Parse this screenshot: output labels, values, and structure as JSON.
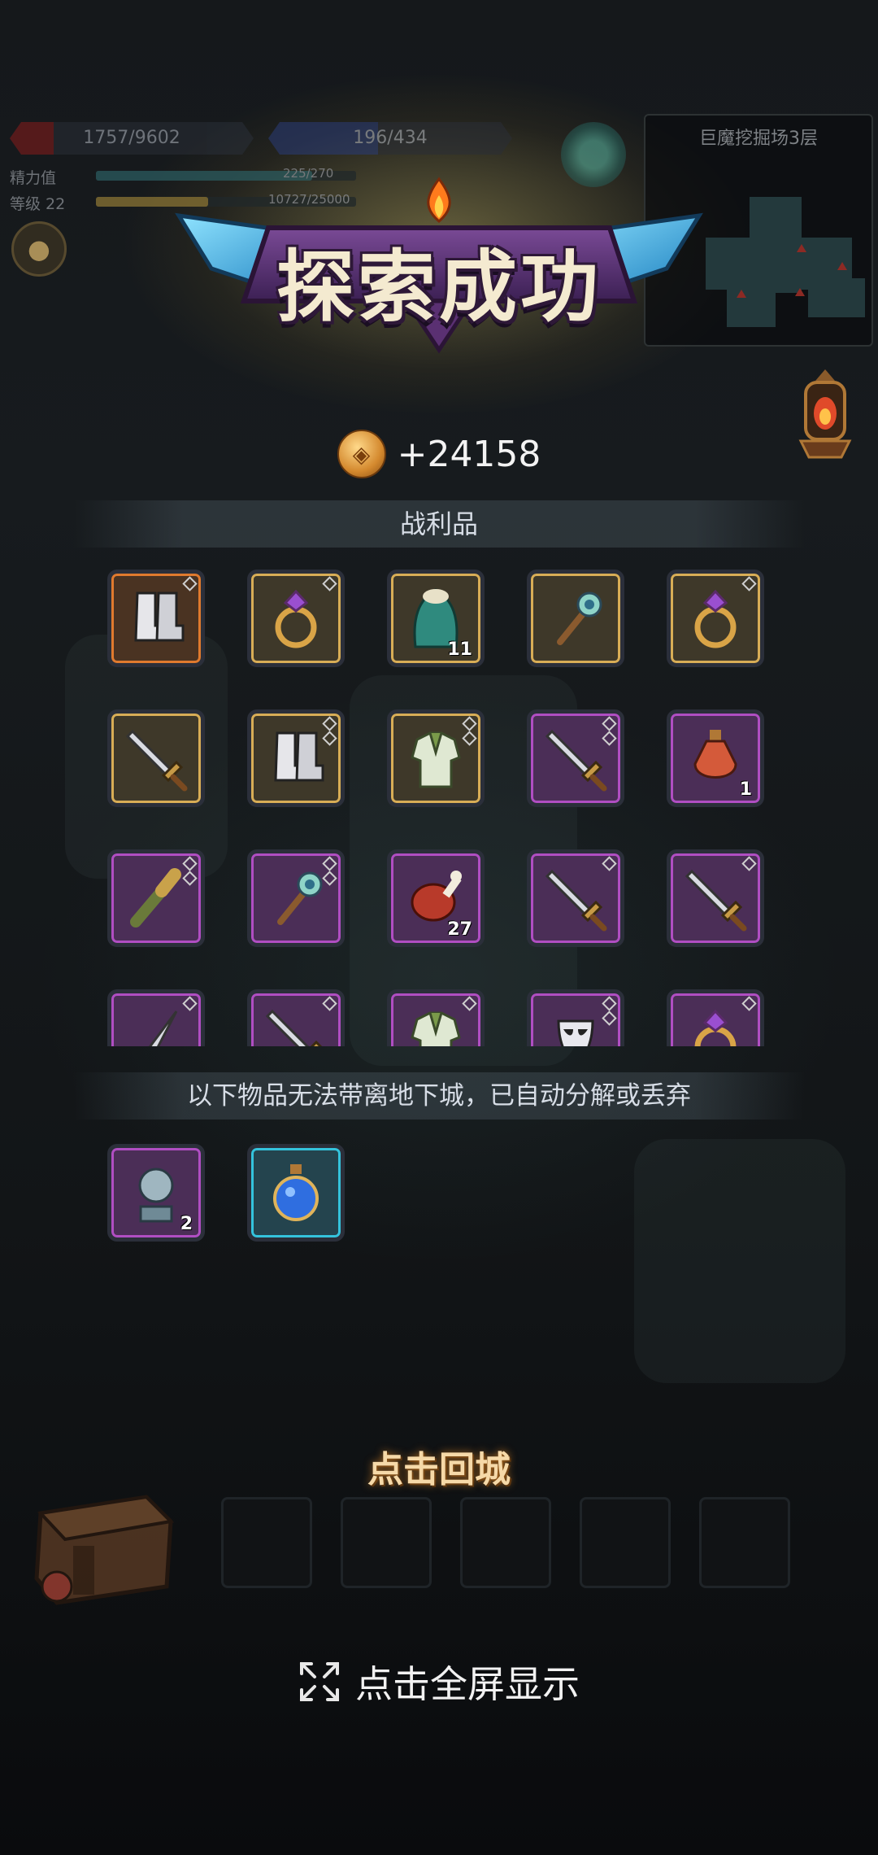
{
  "hud": {
    "hp": "1757/9602",
    "hp_fraction": 0.18,
    "mp": "196/434",
    "mp_fraction": 0.45,
    "stamina_label": "精力值",
    "stamina": "225/270",
    "stamina_fraction": 0.83,
    "level_label": "等级 22",
    "exp": "10727/25000",
    "exp_fraction": 0.43
  },
  "minimap": {
    "title": "巨魔挖掘场3层"
  },
  "banner": {
    "title": "探索成功"
  },
  "reward": {
    "gold": "+24158"
  },
  "loot": {
    "title": "战利品",
    "items": [
      {
        "icon": "boots-icon",
        "rarity": "orange",
        "pips": 1,
        "count": ""
      },
      {
        "icon": "ring-icon",
        "rarity": "gold",
        "pips": 1,
        "count": ""
      },
      {
        "icon": "fur-cloak-icon",
        "rarity": "gold",
        "pips": 0,
        "count": "11"
      },
      {
        "icon": "staff-icon",
        "rarity": "gold",
        "pips": 0,
        "count": ""
      },
      {
        "icon": "ring-icon",
        "rarity": "gold",
        "pips": 1,
        "count": ""
      },
      {
        "icon": "sword-icon",
        "rarity": "gold",
        "pips": 0,
        "count": ""
      },
      {
        "icon": "boots-icon",
        "rarity": "gold",
        "pips": 2,
        "count": ""
      },
      {
        "icon": "armor-icon",
        "rarity": "gold",
        "pips": 2,
        "count": ""
      },
      {
        "icon": "sword-icon",
        "rarity": "purple",
        "pips": 2,
        "count": ""
      },
      {
        "icon": "potion-icon",
        "rarity": "purple",
        "pips": 0,
        "count": "1"
      },
      {
        "icon": "spyglass-icon",
        "rarity": "purple",
        "pips": 2,
        "count": ""
      },
      {
        "icon": "staff-icon",
        "rarity": "purple",
        "pips": 2,
        "count": ""
      },
      {
        "icon": "meat-icon",
        "rarity": "purple",
        "pips": 0,
        "count": "27"
      },
      {
        "icon": "sword-icon",
        "rarity": "purple",
        "pips": 1,
        "count": ""
      },
      {
        "icon": "sword-icon",
        "rarity": "purple",
        "pips": 1,
        "count": ""
      },
      {
        "icon": "dagger-icon",
        "rarity": "purple",
        "pips": 1,
        "count": ""
      },
      {
        "icon": "sword-icon",
        "rarity": "purple",
        "pips": 1,
        "count": ""
      },
      {
        "icon": "armor-icon",
        "rarity": "purple",
        "pips": 1,
        "count": ""
      },
      {
        "icon": "mask-icon",
        "rarity": "purple",
        "pips": 2,
        "count": ""
      },
      {
        "icon": "ring-icon",
        "rarity": "purple",
        "pips": 1,
        "count": ""
      }
    ]
  },
  "discarded": {
    "title": "以下物品无法带离地下城，已自动分解或丢弃",
    "items": [
      {
        "icon": "statue-icon",
        "rarity": "purple",
        "pips": 0,
        "count": "2"
      },
      {
        "icon": "blue-potion-icon",
        "rarity": "cyan",
        "pips": 0,
        "count": ""
      }
    ]
  },
  "actions": {
    "return_label": "点击回城",
    "fullscreen_label": "点击全屏显示"
  },
  "colors": {
    "gold": "#d8ad56",
    "orange": "#e07a2e",
    "purple": "#b04ec2",
    "cyan": "#34c3dc"
  }
}
